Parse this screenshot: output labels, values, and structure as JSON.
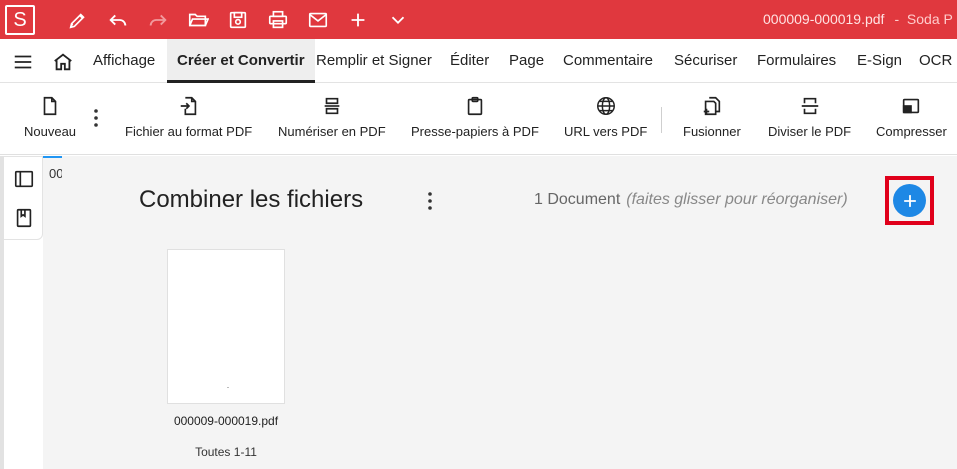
{
  "titlebar": {
    "logo_letter": "S",
    "filename": "000009-000019.pdf",
    "app_name_partial": "Soda P",
    "accent_color": "#e0383e"
  },
  "menubar": {
    "tabs": [
      {
        "label": "Affichage"
      },
      {
        "label": "Créer et Convertir"
      },
      {
        "label": "Remplir et Signer"
      },
      {
        "label": "Éditer"
      },
      {
        "label": "Page"
      },
      {
        "label": "Commentaire"
      },
      {
        "label": "Sécuriser"
      },
      {
        "label": "Formulaires"
      },
      {
        "label": "E-Sign"
      },
      {
        "label": "OCR"
      }
    ],
    "active_tab": "Créer et Convertir"
  },
  "ribbon": {
    "items": [
      {
        "label": "Nouveau",
        "icon": "file-icon"
      },
      {
        "label": "Fichier au format PDF",
        "icon": "file-convert-icon"
      },
      {
        "label": "Numériser en PDF",
        "icon": "scanner-icon"
      },
      {
        "label": "Presse-papiers à PDF",
        "icon": "clipboard-icon"
      },
      {
        "label": "URL vers PDF",
        "icon": "globe-icon"
      },
      {
        "label": "Fusionner",
        "icon": "merge-icon"
      },
      {
        "label": "Diviser le PDF",
        "icon": "split-icon"
      },
      {
        "label": "Compresser",
        "icon": "compress-icon"
      }
    ]
  },
  "tab_peek": {
    "text": "00"
  },
  "main": {
    "title": "Combiner les fichiers",
    "doc_count": "1 Document",
    "hint": "(faites glisser pour réorganiser)",
    "add_color": "#1e88e5",
    "highlight_color": "#e0001b",
    "files": [
      {
        "name": "000009-000019.pdf",
        "pages": "Toutes 1-11"
      }
    ]
  }
}
